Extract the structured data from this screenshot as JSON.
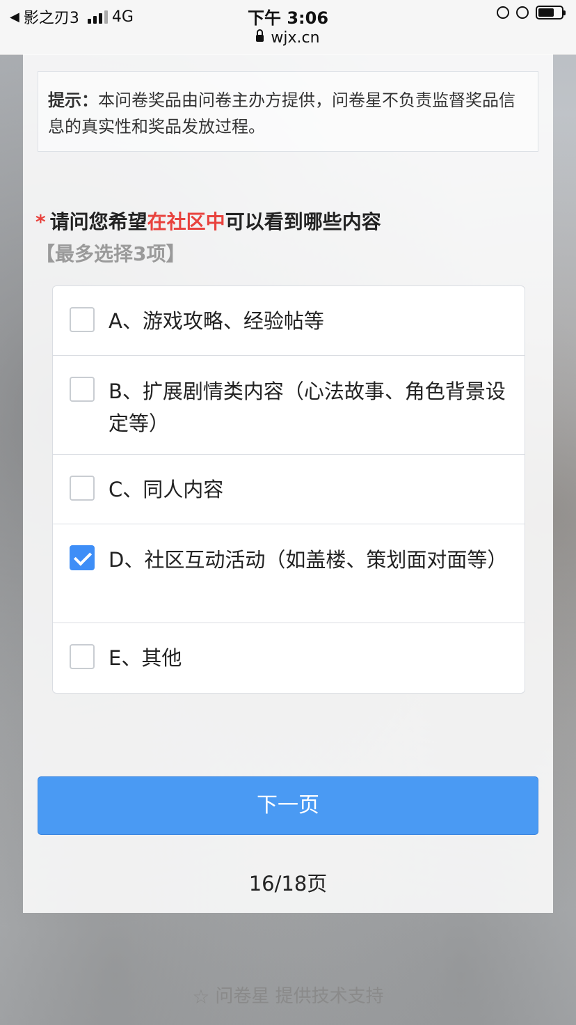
{
  "status_bar": {
    "carrier": "影之刃3",
    "network": "4G",
    "time": "下午 3:06",
    "url": "wjx.cn"
  },
  "tip": {
    "label": "提示：",
    "text": "本问卷奖品由问卷主办方提供，问卷星不负责监督奖品信息的真实性和奖品发放过程。"
  },
  "question": {
    "required_mark": "*",
    "text_before": "请问您希望",
    "text_highlight": "在社区中",
    "text_after": "可以看到哪些内容",
    "limit": "【最多选择3项】"
  },
  "options": [
    {
      "label": "A、游戏攻略、经验帖等",
      "checked": false
    },
    {
      "label": "B、扩展剧情类内容（心法故事、角色背景设定等）",
      "checked": false
    },
    {
      "label": "C、同人内容",
      "checked": false
    },
    {
      "label": "D、社区互动活动（如盖楼、策划面对面等）",
      "checked": true
    },
    {
      "label": "E、其他",
      "checked": false
    }
  ],
  "next_button": "下一页",
  "pager": "16/18页",
  "footer": "问卷星 提供技术支持",
  "colors": {
    "accent": "#4a9af3",
    "checkbox_checked": "#3e8ef7",
    "required": "#e8423d"
  }
}
